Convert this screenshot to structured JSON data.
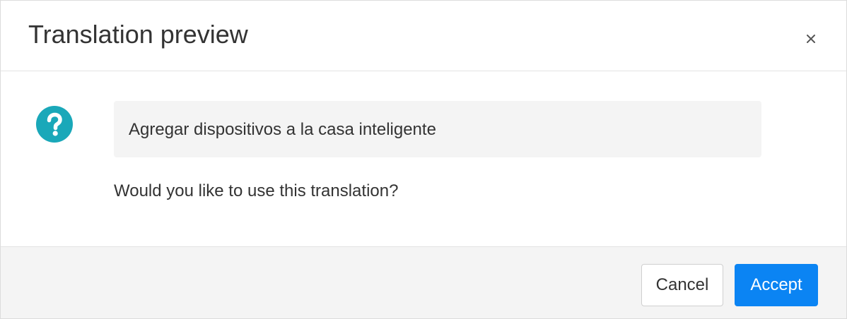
{
  "dialog": {
    "title": "Translation preview",
    "close_label": "×",
    "translation_text": "Agregar dispositivos a la casa inteligente",
    "prompt": "Would you like to use this translation?",
    "icons": {
      "status": "question-icon",
      "close": "close-icon"
    },
    "colors": {
      "icon": "#1aa8b9",
      "accent": "#0b84f3",
      "footer_bg": "#f4f4f4",
      "preview_bg": "#f4f4f4"
    }
  },
  "buttons": {
    "cancel_label": "Cancel",
    "accept_label": "Accept"
  }
}
